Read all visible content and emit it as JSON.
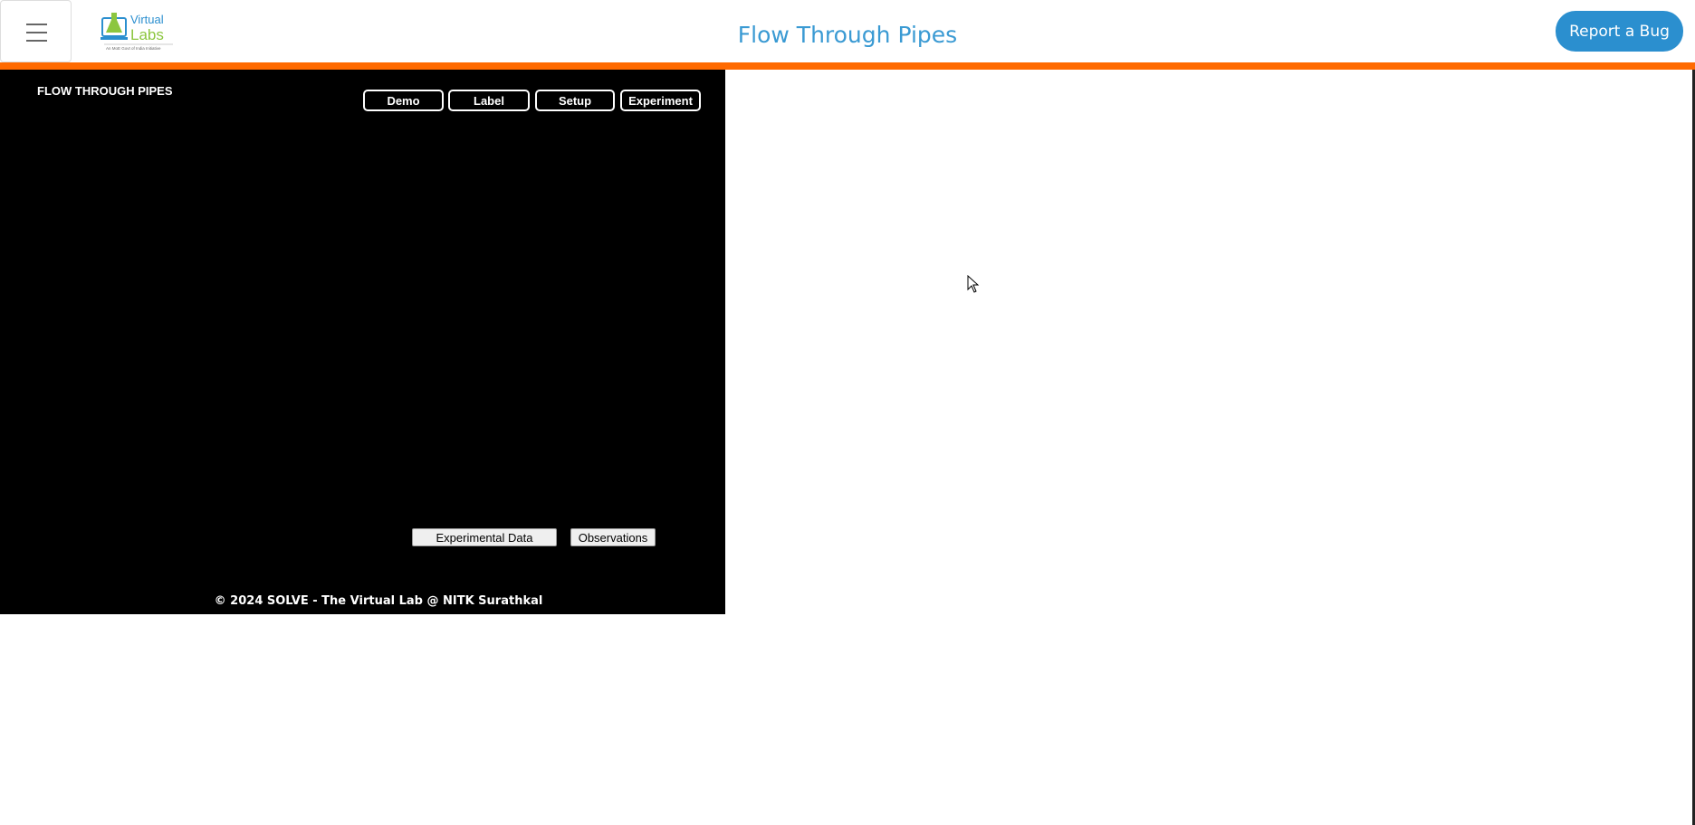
{
  "header": {
    "menu_icon": "hamburger-icon",
    "logo": {
      "text_top": "Virtual",
      "text_bottom": "Labs",
      "tagline": "An MoE Govt of India Initiative"
    },
    "title": "Flow Through Pipes",
    "report_bug_label": "Report a Bug"
  },
  "colors": {
    "accent_orange": "#ff6a00",
    "title_blue": "#3a9ad3",
    "button_blue": "#2b8fcf",
    "panel_bg": "#000000"
  },
  "simulation": {
    "title": "FLOW THROUGH PIPES",
    "nav_buttons": [
      "Demo",
      "Label",
      "Setup",
      "Experiment"
    ],
    "experimental_data_label": "Experimental Data",
    "observations_label": "Observations",
    "footer": "© 2024 SOLVE - The Virtual Lab @ NITK Surathkal"
  }
}
